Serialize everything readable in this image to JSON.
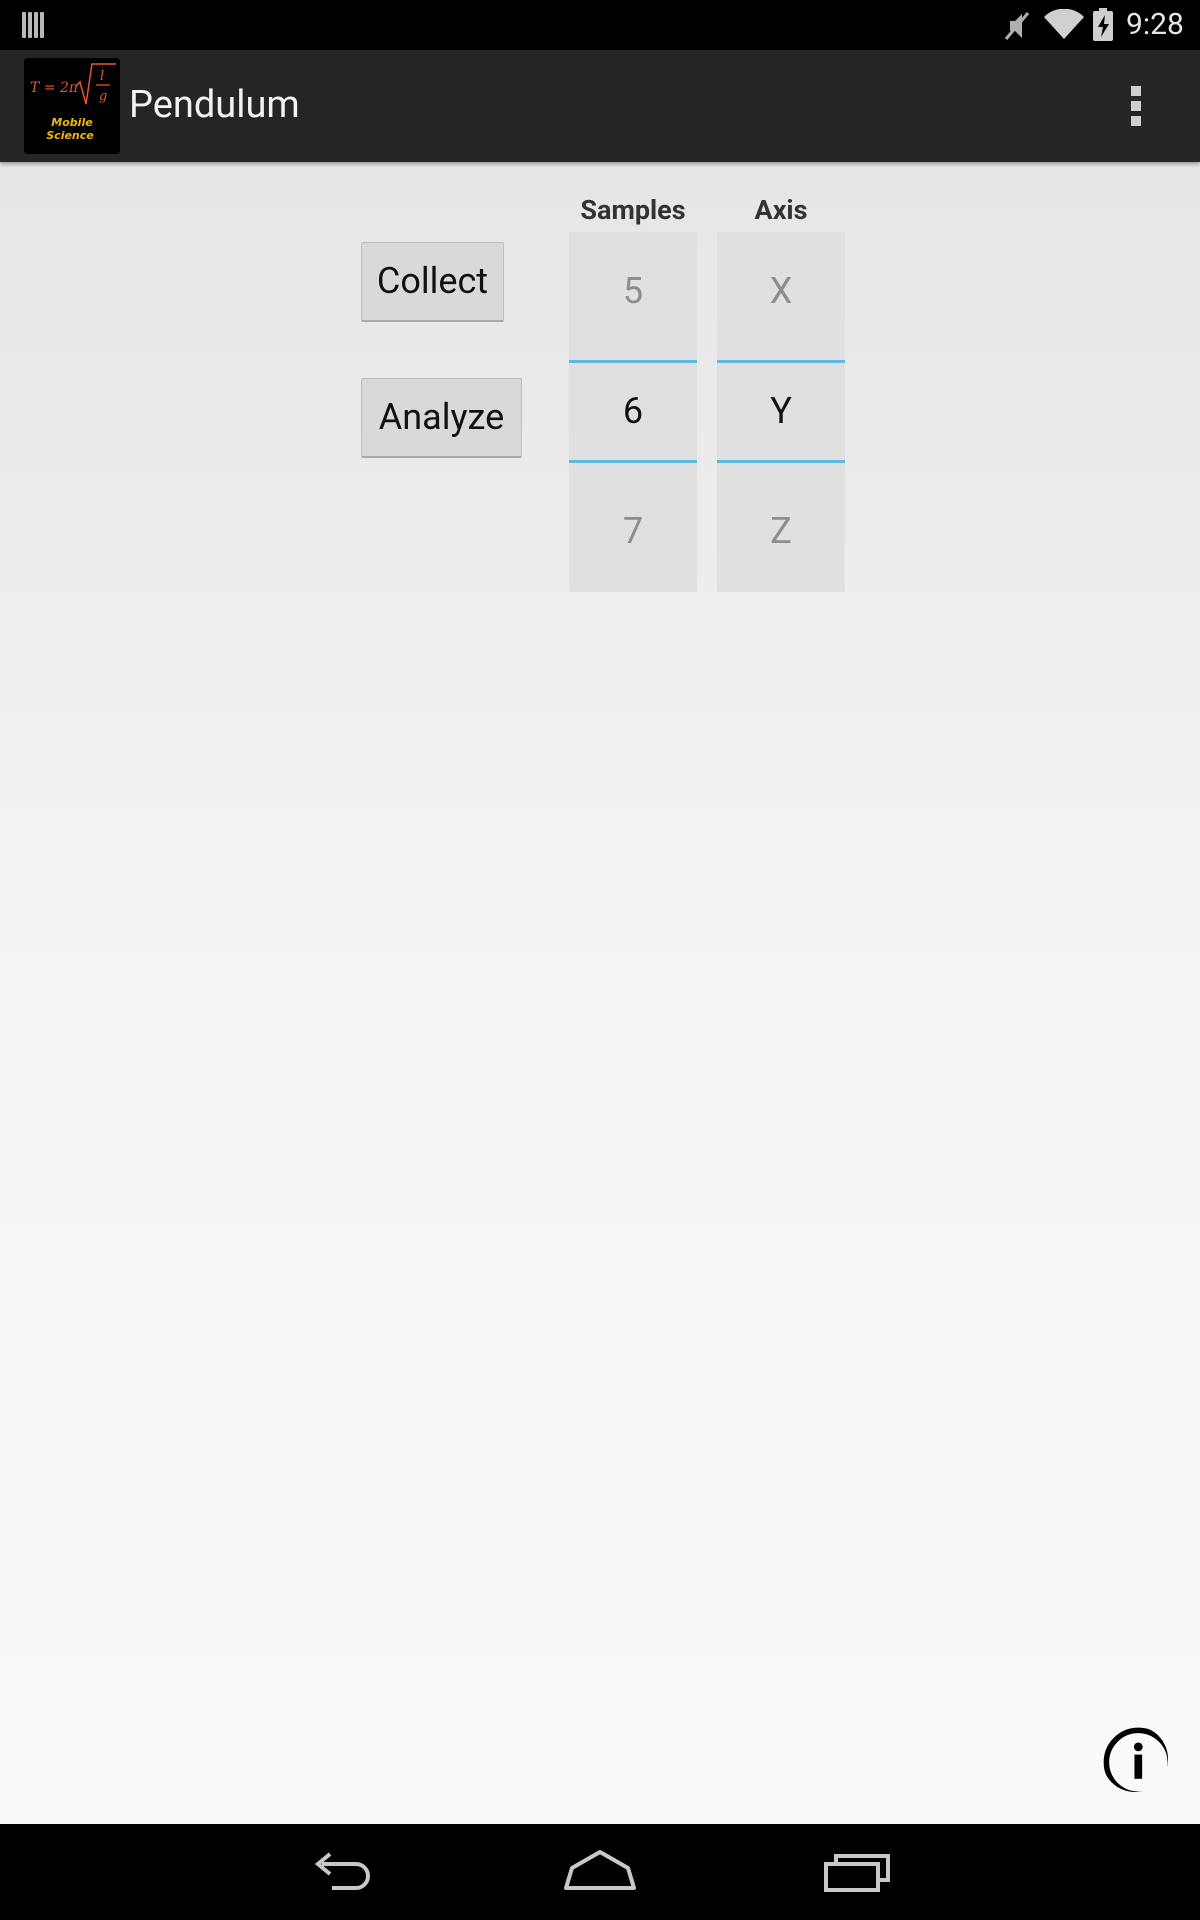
{
  "status_bar": {
    "time": "9:28",
    "icons": [
      "notification-bars-icon",
      "mute-icon",
      "wifi-icon",
      "battery-charging-icon"
    ]
  },
  "action_bar": {
    "title": "Pendulum",
    "logo": {
      "formula": "T = 2π √(l/g)",
      "caption_line1": "Mobile",
      "caption_line2": "Science",
      "formula_color": "#e8562a",
      "caption_color": "#f2b705"
    },
    "overflow_icon": "overflow-menu-icon"
  },
  "buttons": {
    "collect_label": "Collect",
    "analyze_label": "Analyze"
  },
  "samples_picker": {
    "label": "Samples",
    "above": "5",
    "selected": "6",
    "below": "7"
  },
  "axis_picker": {
    "label": "Axis",
    "above": "X",
    "selected": "Y",
    "below": "Z"
  },
  "info_icon": "info-icon",
  "nav_bar": {
    "icons": [
      "back-icon",
      "home-icon",
      "recents-icon"
    ]
  },
  "colors": {
    "accent": "#5fb8df",
    "action_bar": "#252525",
    "picker_bg": "#e0e0e0"
  }
}
